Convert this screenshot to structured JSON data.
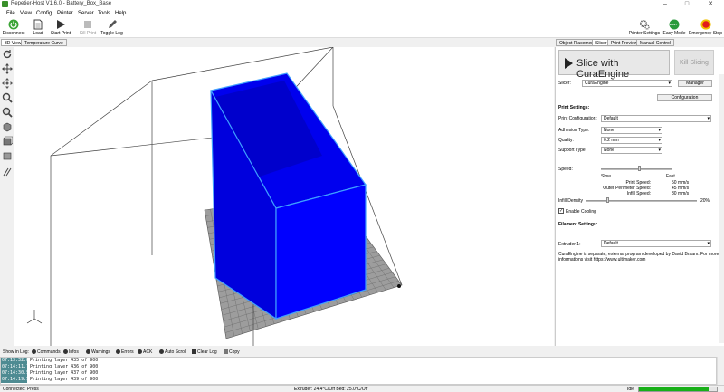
{
  "window": {
    "title": "Repetier-Host V1.6.0 - Battery_Box_Base",
    "min": "–",
    "max": "□",
    "close": "✕"
  },
  "menu": [
    "File",
    "View",
    "Config",
    "Printer",
    "Server",
    "Tools",
    "Help"
  ],
  "toolbar": {
    "disconnect": "Disconnect",
    "load": "Load",
    "start_print": "Start Print",
    "kill_print": "Kill Print",
    "toggle_log": "Toggle Log",
    "printer_settings": "Printer Settings",
    "easy_mode": "Easy Mode",
    "emergency_stop": "Emergency Stop",
    "easy_badge": "EASY"
  },
  "left_tabs": [
    "3D View",
    "Temperature Curve"
  ],
  "right_tabs": [
    "Object Placement",
    "Slicer",
    "Print Preview",
    "Manual Control"
  ],
  "slicer": {
    "slice_label": "Slice with CuraEngine",
    "kill_label": "Kill Slicing",
    "slicer_label": "Slicer:",
    "slicer_value": "CuraEngine",
    "manager_label": "Manager",
    "configuration_label": "Configuration",
    "print_settings_heading": "Print Settings:",
    "print_configuration_label": "Print Configuration:",
    "print_configuration_value": "Default",
    "adhesion_label": "Adhesion Type:",
    "adhesion_value": "None",
    "quality_label": "Quality:",
    "quality_value": "0.2 mm",
    "support_label": "Support Type:",
    "support_value": "None",
    "speed_label": "Speed:",
    "speed_level": 0.55,
    "slow_label": "Slow",
    "fast_label": "Fast",
    "print_speed_label": "Print Speed:",
    "print_speed_value": "50 mm/s",
    "outer_perimeter_label": "Outer Perimeter Speed:",
    "outer_perimeter_value": "45 mm/s",
    "infill_speed_label": "Infill Speed:",
    "infill_speed_value": "80 mm/s",
    "infill_density_label": "Infill Density",
    "infill_density_value": "20%",
    "infill_density_level": 0.2,
    "enable_cooling_label": "Enable Cooling",
    "filament_heading": "Filament Settings:",
    "extruder_label": "Extruder 1:",
    "extruder_value": "Default",
    "note_line1": "CuraEngine is separate, external program developed by David Braam. For more",
    "note_line2": "informations visit https://www.ultimaker.com"
  },
  "log_bar": {
    "show_in_log": "Show in Log:",
    "commands": "Commands",
    "infos": "Infos",
    "warnings": "Warnings",
    "errors": "Errors",
    "ack": "ACK",
    "auto_scroll": "Auto Scroll",
    "clear_log": "Clear Log",
    "copy": "Copy"
  },
  "log_rows": [
    {
      "time": "07:13:32.853",
      "msg": "Printing layer 435 of 900"
    },
    {
      "time": "07:14:11.799",
      "msg": "Printing layer 436 of 900"
    },
    {
      "time": "07:14:30.598",
      "msg": "Printing layer 437 of 900"
    },
    {
      "time": "07:14:19.510",
      "msg": "Printing layer 439 of 900"
    }
  ],
  "status": {
    "connection": "Connected: Press",
    "temps": "Extruder: 24.4°C/Off Bed: 25.0°C/Off",
    "state": "Idle",
    "progress": 0.9
  },
  "colors": {
    "model": "#0000ee",
    "model_edge": "#3fa0ff",
    "bed": "#9d9d9d",
    "progress": "#19b019",
    "log_timestamp": "#4e8b92"
  }
}
